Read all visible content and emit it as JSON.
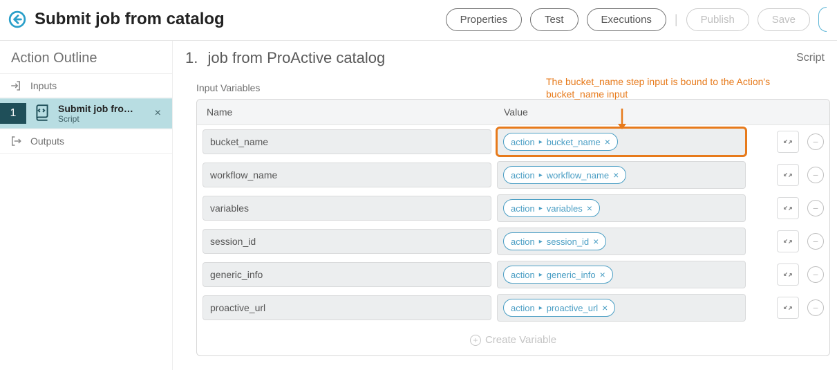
{
  "header": {
    "title": "Submit job from catalog",
    "buttons": {
      "properties": "Properties",
      "test": "Test",
      "executions": "Executions",
      "publish": "Publish",
      "save": "Save"
    }
  },
  "sidebar": {
    "title": "Action Outline",
    "inputs_label": "Inputs",
    "outputs_label": "Outputs",
    "step": {
      "number": "1",
      "name": "Submit job fro…",
      "sub": "Script"
    }
  },
  "main": {
    "number": "1.",
    "title": "job from ProActive catalog",
    "tag": "Script",
    "section_label": "Input Variables",
    "col_name": "Name",
    "col_value": "Value",
    "create_label": "Create Variable",
    "rows": [
      {
        "name": "bucket_name",
        "src": "action",
        "ref": "bucket_name",
        "highlight": true
      },
      {
        "name": "workflow_name",
        "src": "action",
        "ref": "workflow_name",
        "highlight": false
      },
      {
        "name": "variables",
        "src": "action",
        "ref": "variables",
        "highlight": false
      },
      {
        "name": "session_id",
        "src": "action",
        "ref": "session_id",
        "highlight": false
      },
      {
        "name": "generic_info",
        "src": "action",
        "ref": "generic_info",
        "highlight": false
      },
      {
        "name": "proactive_url",
        "src": "action",
        "ref": "proactive_url",
        "highlight": false
      }
    ]
  },
  "annotation": {
    "line1": "The bucket_name step input is bound to the Action's",
    "line2": "bucket_name input"
  }
}
